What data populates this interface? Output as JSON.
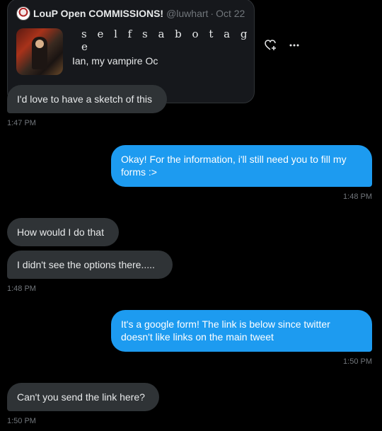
{
  "shared_tweet": {
    "author_name": "LouP Open COMMISSIONS!",
    "handle": "@luwhart",
    "separator": "·",
    "date": "Oct 22",
    "title": "s e l f  s a b o t a g e",
    "description": "Ian, my vampire Oc"
  },
  "messages": [
    {
      "side": "received",
      "text": "I'd love to have a sketch of this"
    },
    {
      "side": "sent",
      "text": "Okay! For the information, i'll still need you to fill my forms :>"
    },
    {
      "side": "received",
      "text": "How would I do that"
    },
    {
      "side": "received",
      "text": "I didn't  see the options there....."
    },
    {
      "side": "sent",
      "text": "It's a google form! The link is below since twitter doesn't like links on the main tweet"
    },
    {
      "side": "received",
      "text": "Can't you send the link here?"
    }
  ],
  "timestamps": [
    "1:47 PM",
    "1:48 PM",
    "1:48 PM",
    "1:50 PM",
    "1:50 PM"
  ],
  "icons": {
    "react": "heart-plus-icon",
    "more": "more-icon"
  },
  "colors": {
    "background": "#000000",
    "received_bubble": "#2f3336",
    "sent_bubble": "#1d9bf0",
    "timestamp": "#71767b"
  }
}
